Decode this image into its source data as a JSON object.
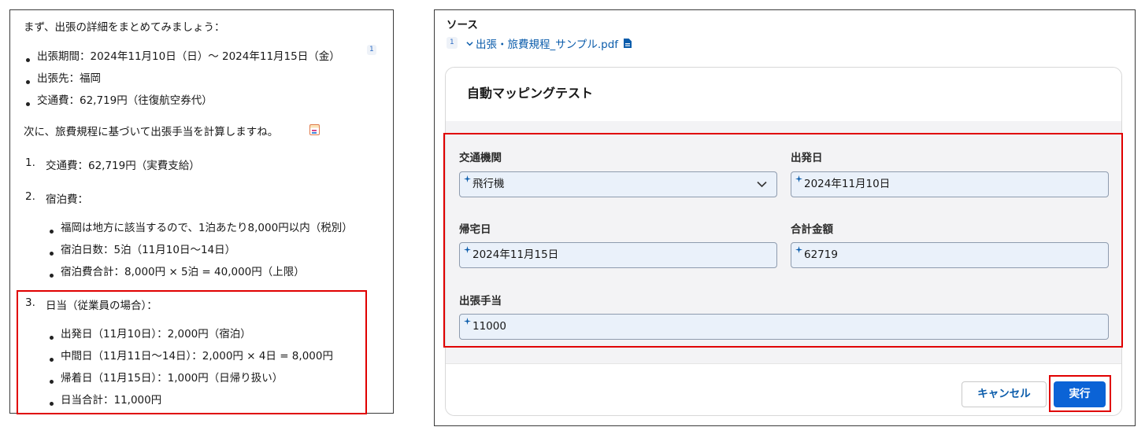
{
  "chat": {
    "intro": "まず、出張の詳細をまとめてみましょう：",
    "summary": [
      "出張期間：2024年11月10日（日）〜 2024年11月15日（金）",
      "出張先：福岡",
      "交通費：62,719円（往復航空券代）"
    ],
    "citation": "1",
    "next_line": "次に、旅費規程に基づいて出張手当を計算しますね。",
    "steps": [
      {
        "label": "1.",
        "text": "交通費：62,719円（実費支給）",
        "subs": []
      },
      {
        "label": "2.",
        "text": "宿泊費：",
        "subs": [
          "福岡は地方に該当するので、1泊あたり8,000円以内（税別）",
          "宿泊日数：5泊（11月10日〜14日）",
          "宿泊費合計：8,000円 × 5泊 = 40,000円（上限）"
        ]
      },
      {
        "label": "3.",
        "text": "日当（従業員の場合）：",
        "subs": [
          "出発日（11月10日）：2,000円（宿泊）",
          "中間日（11月11日〜14日）：2,000円 × 4日 = 8,000円",
          "帰着日（11月15日）：1,000円（日帰り扱い）",
          "日当合計：11,000円"
        ]
      }
    ]
  },
  "source": {
    "title": "ソース",
    "number": "1",
    "file_name": "出張・旅費規程_サンプル.pdf"
  },
  "form": {
    "title": "自動マッピングテスト",
    "fields": {
      "transport": {
        "label": "交通機関",
        "value": "飛行機"
      },
      "departure": {
        "label": "出発日",
        "value": "2024年11月10日"
      },
      "return": {
        "label": "帰宅日",
        "value": "2024年11月15日"
      },
      "total": {
        "label": "合計金額",
        "value": "62719"
      },
      "allowance": {
        "label": "出張手当",
        "value": "11000"
      }
    },
    "cancel_label": "キャンセル",
    "run_label": "実行"
  },
  "colors": {
    "highlight": "#e00000",
    "link": "#0b5cab",
    "primary_button": "#0b63d6",
    "input_bg": "#eaf1fa"
  }
}
